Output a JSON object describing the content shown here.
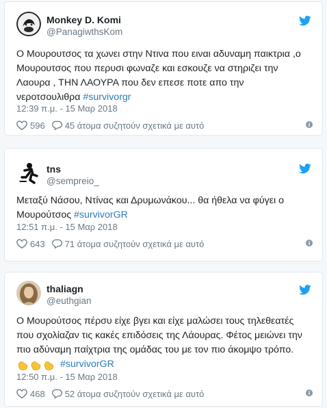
{
  "colors": {
    "text": "#1c2022",
    "secondary": "#697882",
    "hashtag": "#2b7bb9",
    "twitter_blue": "#1da1f2",
    "card_border": "#e1e8ed",
    "background": "#f5f8fa"
  },
  "tweets": [
    {
      "name": "Monkey D. Komi",
      "handle": "@PanagiwthsKom",
      "lines": [
        "Ο Μουρουτσος τα χωνει στην Ντινα που ειναι αδυναμη παικτρια ,ο",
        "Μουρουτσος που περυσι φωναζε και εσκουζε να στηριζει την",
        "Λαουρα , ΤΗΝ ΛΑΟΥΡΑ που δεν επεσε ποτε απο την",
        "νεροτσουλιθρα"
      ],
      "hashtag": "#survivorgr",
      "time": "12:39 π.μ. - 15 Μαρ 2018",
      "likes": "596",
      "replies": "45 άτομα συζητούν σχετικά με αυτό",
      "icons": {
        "avatar": "avatar-icon",
        "bird": "twitter-bird-icon",
        "like": "heart-icon",
        "reply": "speech-bubble-icon",
        "info": "info-icon"
      }
    },
    {
      "name": "tns",
      "handle": "@sempreio_",
      "lines": [
        "Μεταξύ Νάσου, Ντίνας και Δρυμωνάκου... θα ήθελα να φύγει ο",
        "Μουρούτσος"
      ],
      "hashtag": "#survivorGR",
      "time": "12:51 π.μ. - 15 Μαρ 2018",
      "likes": "643",
      "replies": "71 άτομα συζητούν σχετικά με αυτό",
      "icons": {
        "avatar": "runner-avatar-icon",
        "bird": "twitter-bird-icon",
        "like": "heart-icon",
        "reply": "speech-bubble-icon",
        "info": "info-icon"
      }
    },
    {
      "name": "thaliagn",
      "handle": "@euthgian",
      "lines": [
        "Ο Μουρούτσος πέρσυ είχε βγει και είχε μαλώσει τους τηλεθεατές",
        "που σχολίαζαν τις κακές επιδόσεις της Λάουρας. Φέτος μειώνει την",
        "πιο αδύναμη παίχτρια της ομάδας του με τον πιο άκομψο τρόπο."
      ],
      "emoji": "clapping-hands-emoji",
      "hashtag": "#survivorGR",
      "time": "12:50 π.μ. - 15 Μαρ 2018",
      "likes": "468",
      "replies": "52 άτομα συζητούν σχετικά με αυτό",
      "icons": {
        "avatar": "avatar-icon",
        "bird": "twitter-bird-icon",
        "like": "heart-icon",
        "reply": "speech-bubble-icon",
        "info": "info-icon"
      }
    }
  ]
}
